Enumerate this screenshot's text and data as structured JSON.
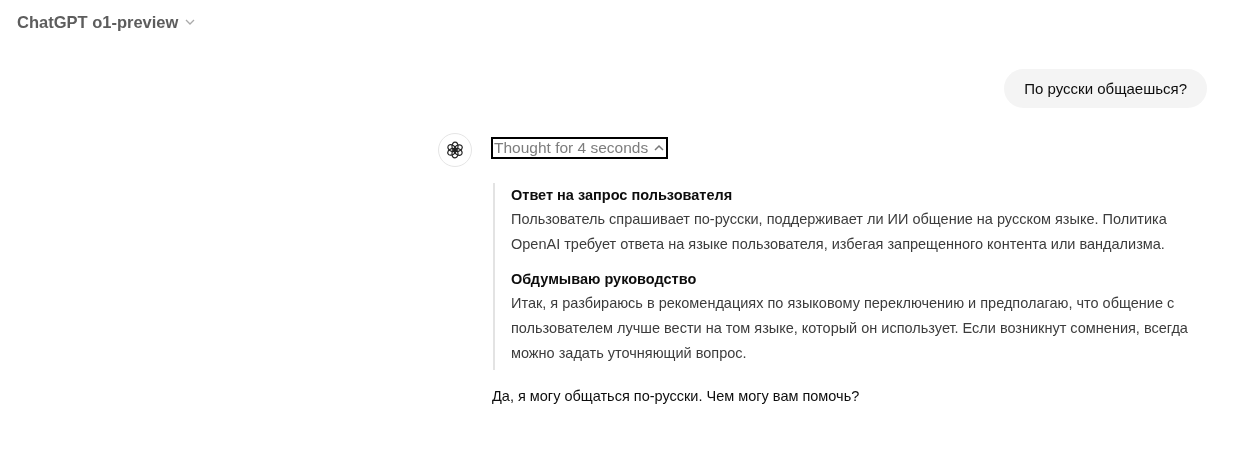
{
  "header": {
    "model_title": "ChatGPT o1-preview"
  },
  "messages": [
    {
      "kind": "user",
      "text": "По русски общаешься?"
    },
    {
      "kind": "assistant",
      "thought": {
        "label": "Thought for 4 seconds",
        "expanded": true,
        "steps": [
          {
            "title": "Ответ на запрос пользователя",
            "text": "Пользователь спрашивает по-русски, поддерживает ли ИИ общение на русском языке. Политика OpenAI требует ответа на языке пользователя, избегая запрещенного контента или вандализма."
          },
          {
            "title": "Обдумываю руководство",
            "text": "Итак, я разбираюсь в рекомендациях по языковому переключению и предполагаю, что общение с пользователем лучше вести на том языке, который он использует. Если возникнут сомнения, всегда можно задать уточняющий вопрос."
          }
        ]
      },
      "text": "Да, я могу общаться по-русски. Чем могу вам помочь?"
    }
  ]
}
